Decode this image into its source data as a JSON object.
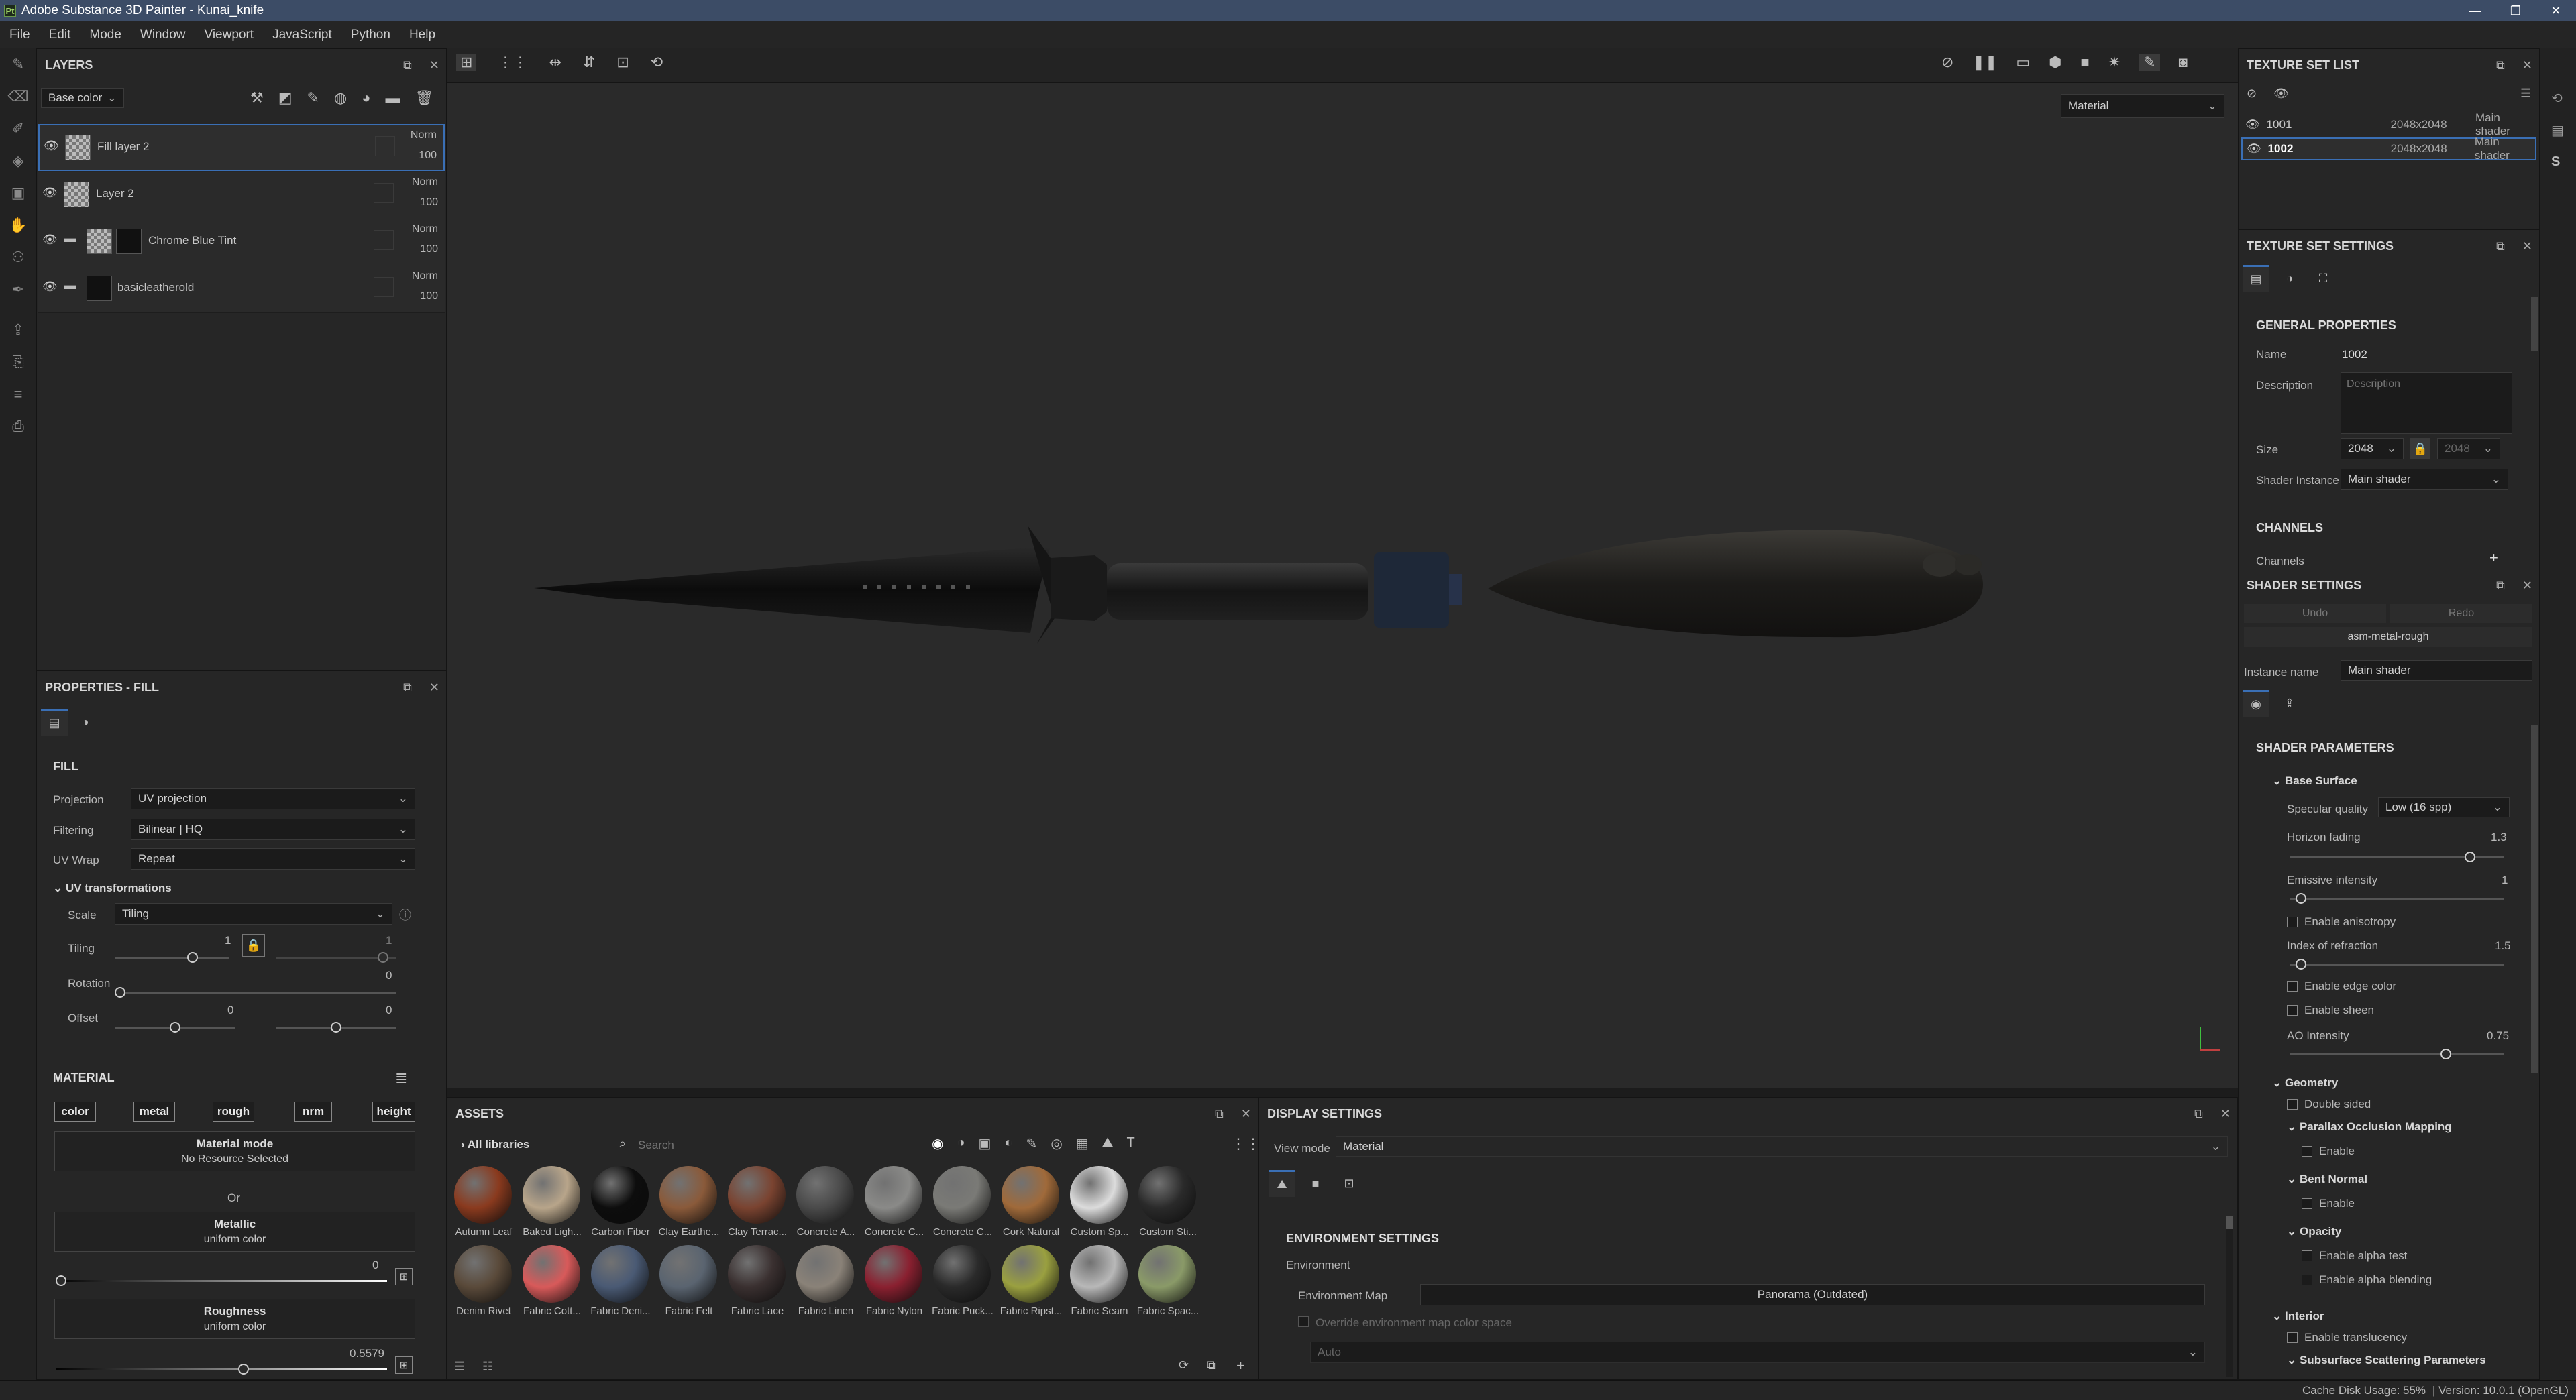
{
  "app": {
    "title": "Adobe Substance 3D Painter - Kunai_knife"
  },
  "window": {
    "minimize": "—",
    "maximize": "❐",
    "close": "✕"
  },
  "menu": [
    "File",
    "Edit",
    "Mode",
    "Window",
    "Viewport",
    "JavaScript",
    "Python",
    "Help"
  ],
  "layers": {
    "title": "LAYERS",
    "channel": "Base color",
    "items": [
      {
        "name": "Fill layer 2",
        "blend": "Norm",
        "opacity": "100"
      },
      {
        "name": "Layer 2",
        "blend": "Norm",
        "opacity": "100"
      },
      {
        "name": "Chrome Blue Tint",
        "blend": "Norm",
        "opacity": "100"
      },
      {
        "name": "basicleatherold",
        "blend": "Norm",
        "opacity": "100"
      }
    ]
  },
  "properties": {
    "title": "PROPERTIES - FILL",
    "fill_header": "FILL",
    "projection_label": "Projection",
    "projection": "UV projection",
    "filtering_label": "Filtering",
    "filtering": "Bilinear | HQ",
    "uvwrap_label": "UV Wrap",
    "uvwrap": "Repeat",
    "uvtrans": "UV transformations",
    "scale_label": "Scale",
    "scale": "Tiling",
    "tiling_label": "Tiling",
    "tiling_value": "1",
    "tiling_value2": "1",
    "rotation_label": "Rotation",
    "rotation_value": "0",
    "offset_label": "Offset",
    "offset_value": "0",
    "offset_value2": "0",
    "material_header": "MATERIAL",
    "channels": [
      "color",
      "metal",
      "rough",
      "nrm",
      "height"
    ],
    "material_mode": "Material mode",
    "no_resource": "No Resource Selected",
    "or": "Or",
    "metallic": "Metallic",
    "metallic_sub": "uniform color",
    "metallic_value": "0",
    "roughness": "Roughness",
    "roughness_sub": "uniform color",
    "roughness_value": "0.5579"
  },
  "viewport": {
    "mode": "Material"
  },
  "assets": {
    "title": "ASSETS",
    "library": "All libraries",
    "search_placeholder": "Search",
    "row1": [
      {
        "name": "Autumn Leaf",
        "color": "#8a3a1e"
      },
      {
        "name": "Baked Ligh...",
        "color": "#b8a58a"
      },
      {
        "name": "Carbon Fiber",
        "color": "#0d0d0d"
      },
      {
        "name": "Clay Earthe...",
        "color": "#8a5a3a"
      },
      {
        "name": "Clay Terrac...",
        "color": "#7a4330"
      },
      {
        "name": "Concrete A...",
        "color": "#4a4a4a"
      },
      {
        "name": "Concrete C...",
        "color": "#8a8a88"
      },
      {
        "name": "Concrete C...",
        "color": "#7a7a76"
      },
      {
        "name": "Cork Natural",
        "color": "#a06a3a"
      },
      {
        "name": "Custom Sp...",
        "color": "#dcdcdc"
      },
      {
        "name": "Custom Sti...",
        "color": "#2a2a2a"
      }
    ],
    "row2": [
      {
        "name": "Denim Rivet",
        "color": "#5a4a3a"
      },
      {
        "name": "Fabric Cott...",
        "color": "#d85a5a"
      },
      {
        "name": "Fabric Deni...",
        "color": "#4a5a74"
      },
      {
        "name": "Fabric Felt",
        "color": "#5a6470"
      },
      {
        "name": "Fabric Lace",
        "color": "#3a3030"
      },
      {
        "name": "Fabric Linen",
        "color": "#8a8278"
      },
      {
        "name": "Fabric Nylon",
        "color": "#8a2030"
      },
      {
        "name": "Fabric Puck...",
        "color": "#2a2a2a"
      },
      {
        "name": "Fabric Ripst...",
        "color": "#9aa040"
      },
      {
        "name": "Fabric Seam",
        "color": "#b8b8b8"
      },
      {
        "name": "Fabric Spac...",
        "color": "#8a9a68"
      }
    ]
  },
  "display": {
    "title": "DISPLAY SETTINGS",
    "viewmode_label": "View mode",
    "viewmode": "Material",
    "env_header": "ENVIRONMENT SETTINGS",
    "env_label": "Environment",
    "envmap_label": "Environment Map",
    "envmap": "Panorama (Outdated)",
    "override": "Override environment map color space",
    "auto": "Auto"
  },
  "tsl": {
    "title": "TEXTURE SET LIST",
    "items": [
      {
        "name": "1001",
        "size": "2048x2048",
        "shader": "Main shader"
      },
      {
        "name": "1002",
        "size": "2048x2048",
        "shader": "Main shader"
      }
    ]
  },
  "tss": {
    "title": "TEXTURE SET SETTINGS",
    "general": "GENERAL PROPERTIES",
    "name_label": "Name",
    "name": "1002",
    "desc_label": "Description",
    "desc_placeholder": "Description",
    "size_label": "Size",
    "size": "2048",
    "size2": "2048",
    "shader_label": "Shader Instance",
    "shader": "Main shader",
    "channels_header": "CHANNELS",
    "channels_label": "Channels"
  },
  "shader": {
    "title": "SHADER SETTINGS",
    "undo": "Undo",
    "redo": "Redo",
    "preset": "asm-metal-rough",
    "instance_label": "Instance name",
    "instance": "Main shader",
    "params": "SHADER PARAMETERS",
    "base_surface": "Base Surface",
    "specq_label": "Specular quality",
    "specq": "Low (16 spp)",
    "horizon_label": "Horizon fading",
    "horizon": "1.3",
    "horizon_frac": 0.87,
    "emissive_label": "Emissive intensity",
    "emissive": "1",
    "emissive_frac": 0.03,
    "aniso": "Enable anisotropy",
    "ior_label": "Index of refraction",
    "ior": "1.5",
    "ior_frac": 0.03,
    "edge": "Enable edge color",
    "sheen": "Enable sheen",
    "ao_label": "AO Intensity",
    "ao": "0.75",
    "ao_frac": 0.75,
    "geometry": "Geometry",
    "double": "Double sided",
    "pom": "Parallax Occlusion Mapping",
    "pom_enable": "Enable",
    "bent": "Bent Normal",
    "bent_enable": "Enable",
    "opacity": "Opacity",
    "alpha_test": "Enable alpha test",
    "alpha_blend": "Enable alpha blending",
    "interior": "Interior",
    "translucency": "Enable translucency",
    "sss": "Subsurface Scattering Parameters"
  },
  "status": {
    "cache": "Cache Disk Usage:",
    "cache_value": "55%",
    "version": "| Version: 10.0.1 (OpenGL)"
  }
}
